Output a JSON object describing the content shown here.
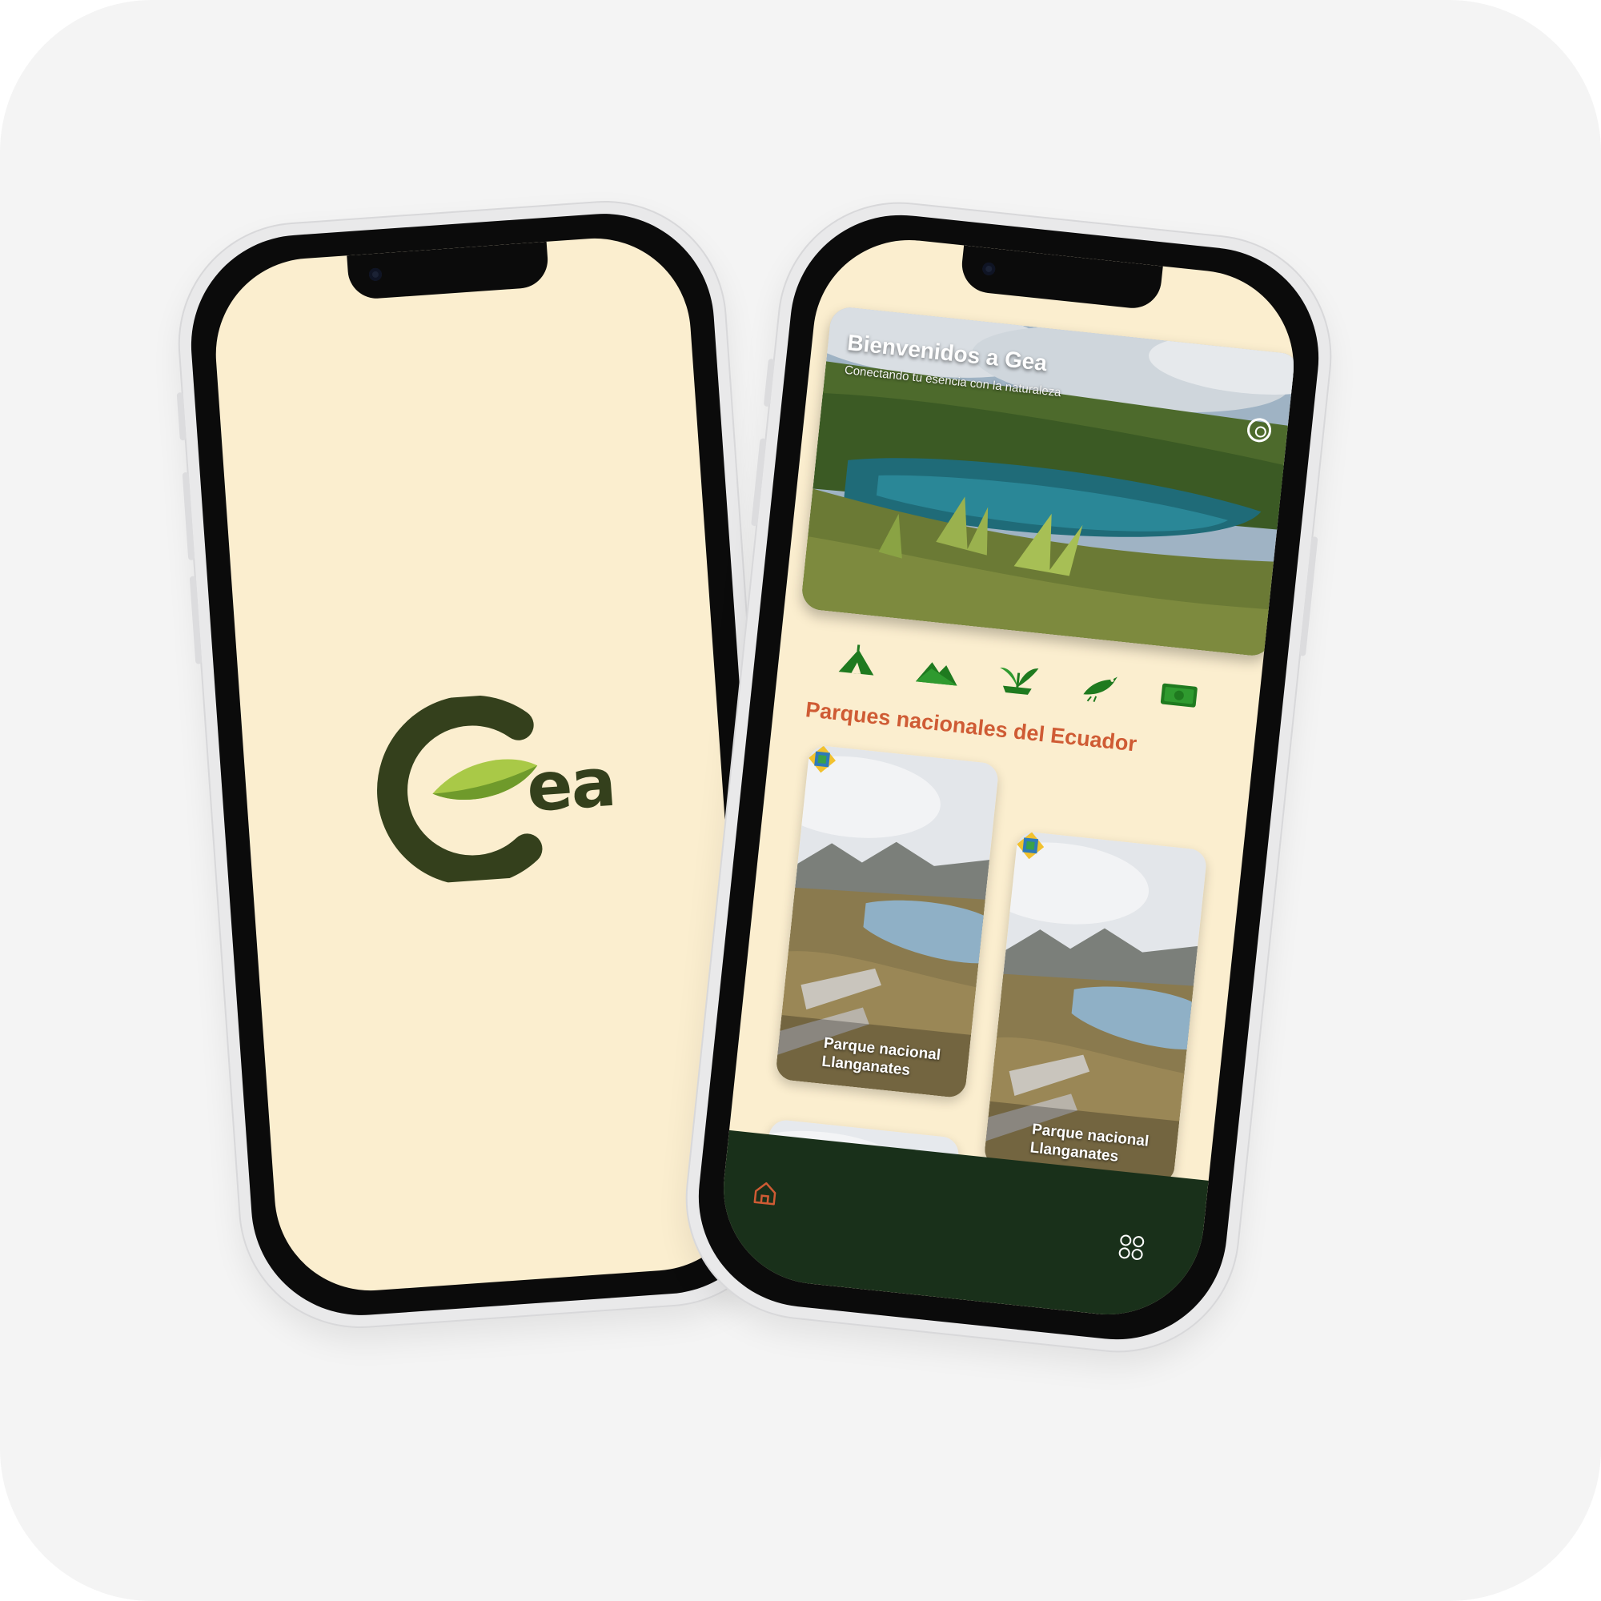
{
  "splash": {
    "logo_letters": "ea",
    "colors": {
      "background": "#fbeecf",
      "logo_dark": "#34401c",
      "leaf_light": "#a9c947",
      "leaf_mid": "#6f9a2b"
    }
  },
  "home": {
    "hero": {
      "title": "Bienvenidos a Gea",
      "subtitle": "Conectando tu esencia con la naturaleza",
      "search_icon": "search-icon"
    },
    "categories": [
      {
        "icon": "camping-tent-icon"
      },
      {
        "icon": "mountains-icon"
      },
      {
        "icon": "plants-icon"
      },
      {
        "icon": "bird-icon"
      },
      {
        "icon": "money-icon"
      }
    ],
    "section_title": "Parques nacionales del Ecuador",
    "parks": [
      {
        "name": "Parque nacional\nLlanganates"
      },
      {
        "name": "Parque nacional\nLlanganates"
      },
      {
        "name": ""
      },
      {
        "name": ""
      }
    ],
    "tabbar": {
      "home_icon": "home-icon",
      "menu_icon": "grid-menu-icon"
    },
    "colors": {
      "accent": "#cf5b34",
      "tabbar": "#19301a",
      "icon_green": "#1f7a1f"
    }
  }
}
